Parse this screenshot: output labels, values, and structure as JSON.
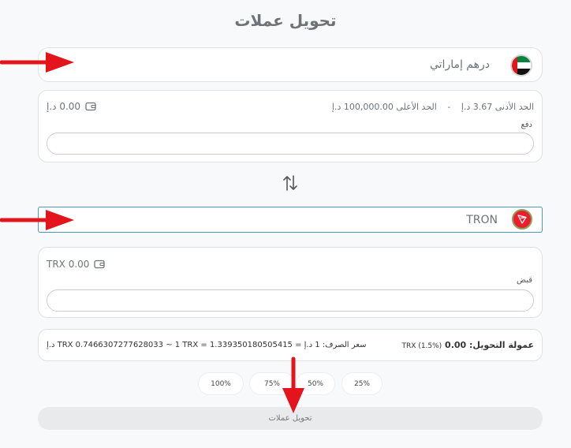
{
  "page": {
    "title": "تحويل عملات"
  },
  "from_currency": {
    "label": "درهم إماراتي",
    "icon": "uae-flag-icon"
  },
  "pay_panel": {
    "min_label": "الحد الأدنى 3.67 د.إ",
    "separator": "-",
    "max_label": "الحد الأعلى 100,000.00 د.إ",
    "balance": "0.00 د.إ",
    "field_label": "دفع",
    "field_value": ""
  },
  "to_currency": {
    "label": "TRON",
    "icon": "tron-icon"
  },
  "receive_panel": {
    "balance": "TRX 0.00",
    "field_label": "قبض",
    "field_value": ""
  },
  "rates": {
    "fee_label": "عمولة التحويل: 0.00",
    "fee_value": "TRX (1.5%)",
    "exchange_rate": "سعر الصرف: 1 د.إ = TRX 0.7466307277628033 ~ 1 TRX = 1.339350180505415 د.إ"
  },
  "percent_buttons": [
    "100%",
    "75%",
    "50%",
    "25%"
  ],
  "submit": {
    "label": "تحويل عملات"
  },
  "colors": {
    "accent_border": "#4b98b8",
    "arrow_red": "#e3141b",
    "tron_red": "#ea1f2e"
  }
}
